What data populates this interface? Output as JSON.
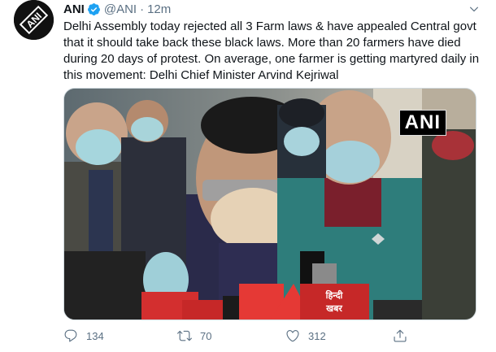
{
  "tweet": {
    "author_name": "ANI",
    "handle": "@ANI",
    "separator": "·",
    "time": "12m",
    "text": "Delhi Assembly today rejected all 3 Farm laws & have appealed Central govt that it should take back these black laws. More than 20 farmers have died during 20 days of protest. On average, one farmer is getting martyred daily in this movement: Delhi Chief Minister Arvind Kejriwal",
    "media": {
      "watermark": "ANI",
      "mic_logo_1": "हिन्दी",
      "mic_logo_2": "खबर"
    },
    "actions": {
      "replies": "134",
      "retweets": "70",
      "likes": "312",
      "share": ""
    }
  },
  "colors": {
    "verified": "#1da1f2",
    "secondary_text": "#5b7083",
    "primary_text": "#0f1419"
  },
  "icons": {
    "avatar": "ani-logo",
    "verified": "verified-badge-icon",
    "caret": "chevron-down-icon",
    "reply": "reply-icon",
    "retweet": "retweet-icon",
    "like": "heart-icon",
    "share": "share-icon"
  }
}
